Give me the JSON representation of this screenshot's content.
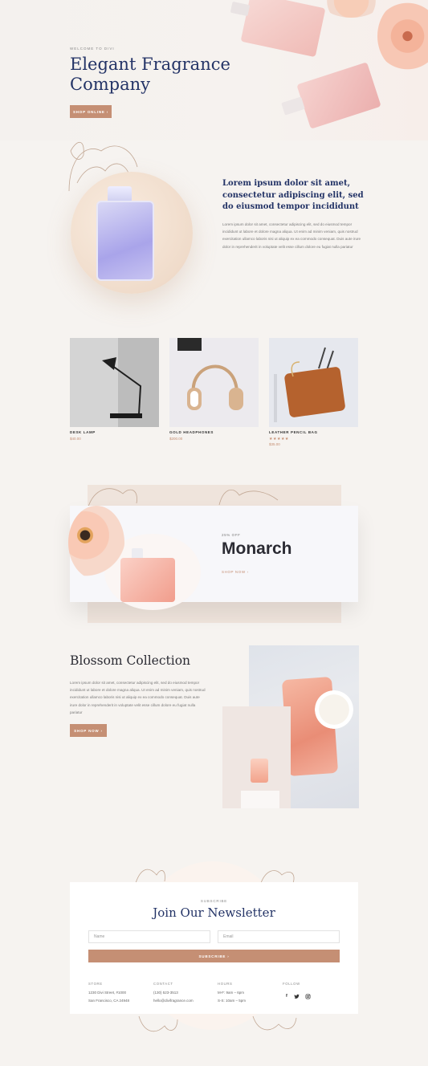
{
  "hero": {
    "eyebrow": "WELCOME TO DIVI",
    "title": "Elegant Fragrance Company",
    "button": "SHOP ONLINE ›"
  },
  "intro": {
    "title": "Lorem ipsum dolor sit amet, consectetur adipiscing elit, sed do eiusmod tempor incididunt",
    "body": "Lorem ipsum dolor sit amet, consectetur adipiscing elit, sed do eiusmod tempor incididunt ut labore et dolore magna aliqua. Ut enim ad minim veniam, quis nostrud exercitation ullamco laboris nisi ut aliquip ex ea commodo consequat. Duis aute irure dolor in reprehenderit in voluptate velit esse cillum dolore eu fugiat nulla pariatur"
  },
  "products": [
    {
      "name": "DESK LAMP",
      "price": "$40.00"
    },
    {
      "name": "GOLD HEADPHONES",
      "price": "$200.00"
    },
    {
      "name": "LEATHER PENCIL BAG",
      "stars": "★★★★★",
      "price": "$35.00"
    }
  ],
  "monarch": {
    "eyebrow": "25% OFF",
    "title": "Monarch",
    "link": "SHOP NOW ›"
  },
  "blossom": {
    "title": "Blossom Collection",
    "body": "Lorem ipsum dolor sit amet, consectetur adipiscing elit, sed do eiusmod tempor incididunt ut labore et dolore magna aliqua. Ut enim ad minim veniam, quis nostrud exercitation ullamco laboris nisi ut aliquip ex ea commodo consequat. Duis aute irure dolor in reprehenderit in voluptate velit esse cillum dolore eu fugiat nulla pariatur",
    "button": "SHOP NOW ›"
  },
  "newsletter": {
    "eyebrow": "SUBSCRIBE",
    "title": "Join Our Newsletter",
    "name_placeholder": "Name",
    "email_placeholder": "Email",
    "button": "SUBSCRIBE ›"
  },
  "footer": {
    "store": {
      "heading": "STORE",
      "line1": "1230 Divi Street, #1000",
      "line2": "San Francisco, CA 24948"
    },
    "contact": {
      "heading": "CONTACT",
      "line1": "(130) 523-3513",
      "line2": "hello@divifragrance.com"
    },
    "hours": {
      "heading": "HOURS",
      "line1": "M-F: 9am – 6pm",
      "line2": "S-S: 10am – 5pm"
    },
    "follow": {
      "heading": "FOLLOW",
      "facebook": "f",
      "twitter": "🐦",
      "instagram": "◎"
    }
  },
  "colors": {
    "accent": "#c58f74",
    "navy": "#233366",
    "background": "#f6f3f0"
  }
}
